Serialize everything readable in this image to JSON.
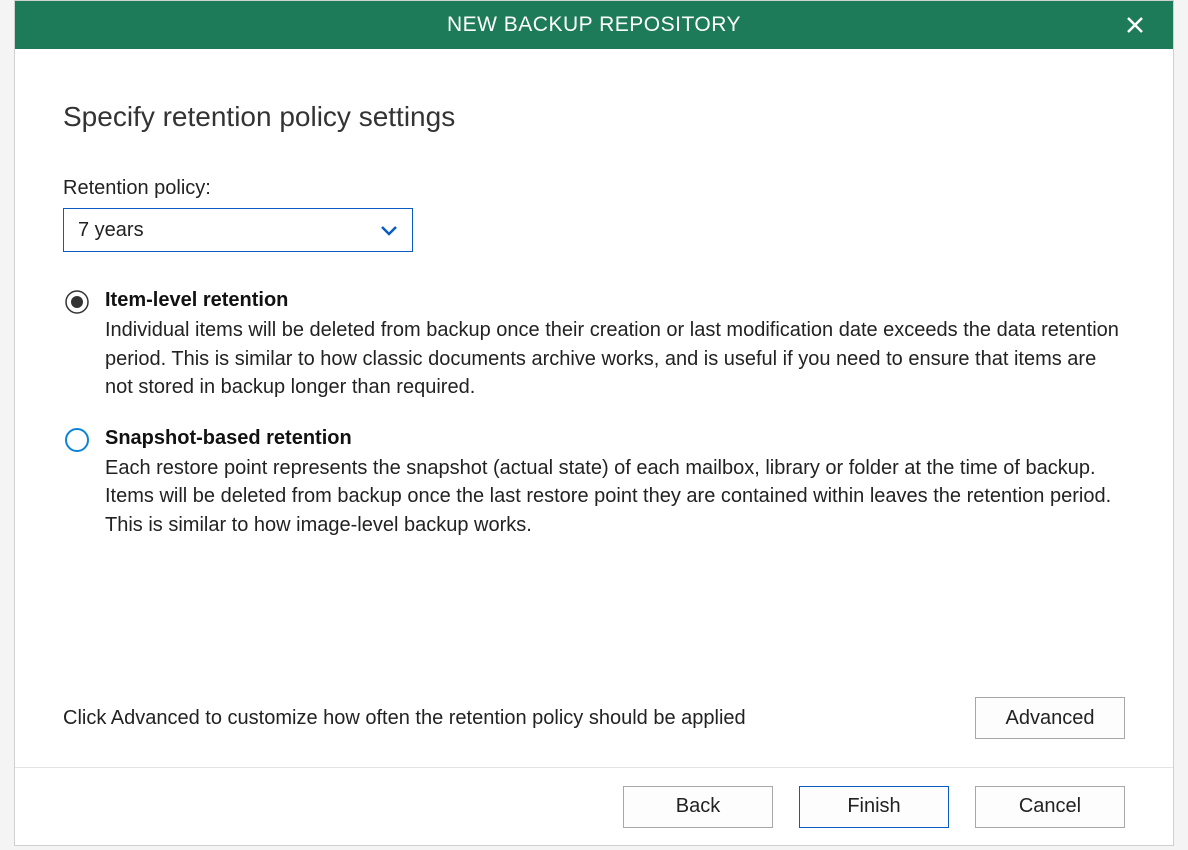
{
  "titlebar": {
    "title": "NEW BACKUP REPOSITORY"
  },
  "page": {
    "heading": "Specify retention policy settings"
  },
  "retention": {
    "label": "Retention policy:",
    "selected": "7 years"
  },
  "options": [
    {
      "name": "Item-level retention",
      "description": "Individual items will be deleted from backup once their creation or last modification date exceeds the data retention period. This is similar to how classic documents archive works, and is useful if you need to ensure that items are not stored in backup longer than required.",
      "selected": true
    },
    {
      "name": "Snapshot-based retention",
      "description": "Each restore point represents the snapshot (actual state) of each mailbox, library or folder at the time of backup. Items will be deleted from backup once the last restore point they are contained within leaves the retention period. This is similar to how image-level backup works.",
      "selected": false
    }
  ],
  "advanced": {
    "hint": "Click Advanced to customize how often the retention policy should be applied",
    "button": "Advanced"
  },
  "footer": {
    "back": "Back",
    "finish": "Finish",
    "cancel": "Cancel"
  }
}
